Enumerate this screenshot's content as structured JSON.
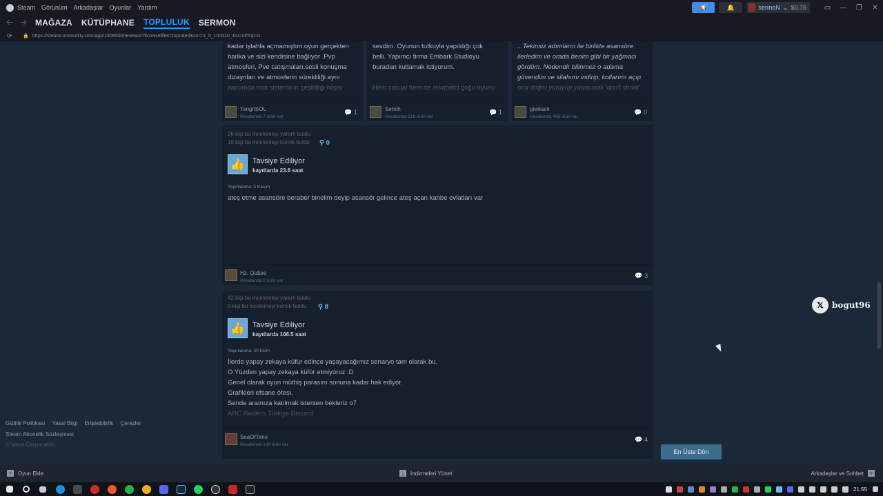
{
  "titlebar": {
    "menu": [
      "Steam",
      "Görünüm",
      "Arkadaşlar",
      "Oyunlar",
      "Yardım"
    ],
    "user_name": "sermoN",
    "balance": "$0.75"
  },
  "nav": {
    "items": [
      "MAĞAZA",
      "KÜTÜPHANE",
      "TOPLULUK",
      "SERMON"
    ],
    "active": "TOPLULUK"
  },
  "url": "https://steamcommunity.com/app/1808500/reviews/?browsefilter=toprated&snr=1_5_100010_&scrollTop=0",
  "mini_cards": [
    {
      "body_lines": [
        "kadar iştahla açmamıştım.oyun gerçekten",
        "harika ve sizi kendisine bağlıyor .Pvp",
        "atmosferi, Pve catışmaları.sesli konuşma",
        "dizaynları ve atmosferin sürekliliği aynı"
      ],
      "fade_line": "zamanda root sisteminin çeşitliliği hepsi",
      "author": "TengriSOL",
      "hours": "Hesabında 7 ürün var",
      "comments": "1"
    },
    {
      "body_lines": [
        "sevdim. Oyunun tutkuyla yapıldığı çok",
        "belli. Yapımcı firma Embark Studioyu",
        "buradan kutlamak istiyorum."
      ],
      "fade_line": "Hem casual hem de rekabetci çoğu oyunu",
      "author": "Semih",
      "hours": "Hesabında 216 ürün var",
      "comments": "1"
    },
    {
      "body_lines": [
        "...Tekinsiz adımların ile birlikte asansöre",
        "ilerledim ve orada benim gibi bir yağmacı",
        "gördüm. Nedendir bilinmez o adama",
        "güvendim ve silahımı indirip, kollarımı açıp"
      ],
      "fade_line": "ona doğru yürüyüp yalvarmak 'don't shoot'",
      "author": "giwikani",
      "hours": "Hesabında 468 ürün var",
      "comments": "0"
    }
  ],
  "reviews": [
    {
      "helpful": "26 kişi bu incelemeyi yararlı buldu",
      "funny": "10 kişi bu incelemeyi komik buldu",
      "awards": "0",
      "verdict": "Tavsiye Ediliyor",
      "hours": "kayıtlarda 23.6 saat",
      "posted": "Yayınlanma: 5 Kasım",
      "text_lines": [
        "ateş etme asansöre beraber binelim deyip asansör gelince ateş açan kahbe evlatları var"
      ],
      "fade_line": "",
      "author": "Hz. Qu$ee",
      "playtime": "Hesabında 9 ürün var",
      "comments": "3"
    },
    {
      "helpful": "42 kişi bu incelemeyi yararlı buldu",
      "funny": "5 kişi bu incelemeyi komik buldu",
      "awards": "8",
      "verdict": "Tavsiye Ediliyor",
      "hours": "kayıtlarda 108.5 saat",
      "posted": "Yayınlanma: 30 Ekim",
      "text_lines": [
        "İlerde yapay zekaya küfür edince yaşayacağımız senaryo tam olarak bu.",
        "O Yüzden yapay zekaya küfür etmiyoruz :D",
        "Genel olarak oyun müthiş parasını sonuna kadar hak ediyor.",
        "Grafikleri efsane ötesi.",
        "Sende aramıza katılmak istersen bekleriz o7"
      ],
      "fade_line": "ARC Raiders Türkiye Discord",
      "author": "SeaOfTime",
      "playtime": "Hesabında 149 ürün var",
      "comments": "4"
    }
  ],
  "footer": {
    "links": [
      "Gizlilik Politikası",
      "Yasal Bilgi",
      "Erişilebilirlik",
      "Çerezler"
    ],
    "terms": "Steam Abonelik Sözleşmesi",
    "copyright": "© Valve Corporation."
  },
  "back_to_top": "En Üste Dön",
  "badge": {
    "handle": "bogut96",
    "icon": "x-logo-icon"
  },
  "bottombar": {
    "add_game": "Oyun Ekle",
    "downloads": "İndirmeleri Yönet",
    "friends": "Arkadaşlar ve Sohbet"
  },
  "taskbar": {
    "time": "21:55"
  }
}
